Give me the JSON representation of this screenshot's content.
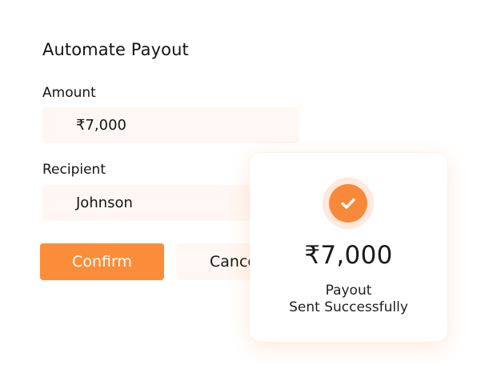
{
  "form": {
    "title": "Automate Payout",
    "amount_label": "Amount",
    "amount_value": "₹7,000",
    "recipient_label": "Recipient",
    "recipient_value": "Johnson",
    "confirm_label": "Confirm",
    "cancel_label": "Cancel"
  },
  "toast": {
    "amount": "₹7,000",
    "line1": "Payout",
    "line2": "Sent Successfully",
    "icon": "check-icon"
  },
  "colors": {
    "accent": "#fb8d3a",
    "field_background": "#fff7f3",
    "ring_background": "#ffe8dc"
  }
}
